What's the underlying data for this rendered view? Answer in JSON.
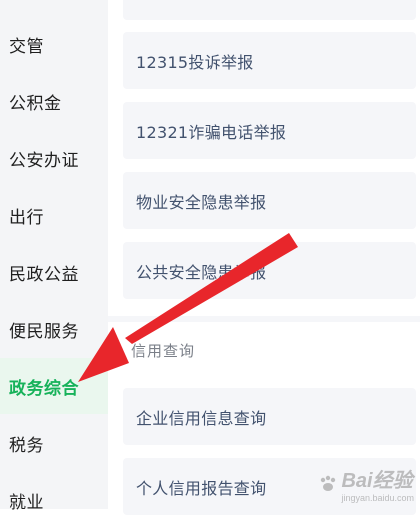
{
  "sidebar": {
    "items": [
      {
        "label": "交管"
      },
      {
        "label": "公积金"
      },
      {
        "label": "公安办证"
      },
      {
        "label": "出行"
      },
      {
        "label": "民政公益"
      },
      {
        "label": "便民服务"
      },
      {
        "label": "政务综合",
        "active": true
      },
      {
        "label": "税务"
      },
      {
        "label": "就业"
      }
    ]
  },
  "main": {
    "report_items": [
      {
        "label": "12315投诉举报"
      },
      {
        "label": "12321诈骗电话举报"
      },
      {
        "label": "物业安全隐患举报"
      },
      {
        "label": "公共安全隐患举报"
      }
    ],
    "credit_section": {
      "title": "信用查询",
      "items": [
        {
          "label": "企业信用信息查询"
        },
        {
          "label": "个人信用报告查询"
        }
      ]
    }
  },
  "overlay": {
    "annotation_arrow_color": "#e8262b",
    "watermark_text": "Bai经验",
    "watermark_sub": "jingyan.baidu.com"
  },
  "colors": {
    "active_text": "#17b25a",
    "active_bg": "#eaf7ee",
    "card_bg": "#f5f6f9",
    "card_text": "#42526e"
  }
}
